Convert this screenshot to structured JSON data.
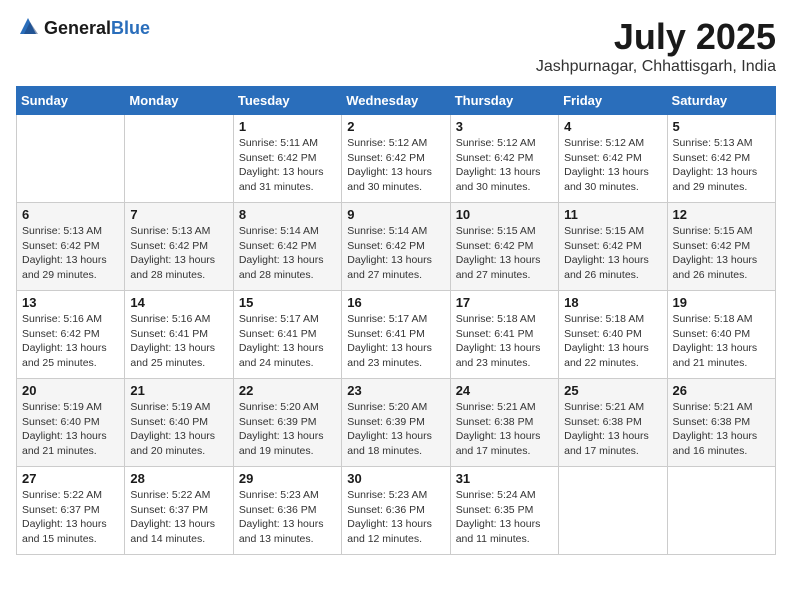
{
  "header": {
    "logo_general": "General",
    "logo_blue": "Blue",
    "month": "July 2025",
    "location": "Jashpurnagar, Chhattisgarh, India"
  },
  "weekdays": [
    "Sunday",
    "Monday",
    "Tuesday",
    "Wednesday",
    "Thursday",
    "Friday",
    "Saturday"
  ],
  "weeks": [
    [
      {
        "day": "",
        "detail": ""
      },
      {
        "day": "",
        "detail": ""
      },
      {
        "day": "1",
        "detail": "Sunrise: 5:11 AM\nSunset: 6:42 PM\nDaylight: 13 hours and 31 minutes."
      },
      {
        "day": "2",
        "detail": "Sunrise: 5:12 AM\nSunset: 6:42 PM\nDaylight: 13 hours and 30 minutes."
      },
      {
        "day": "3",
        "detail": "Sunrise: 5:12 AM\nSunset: 6:42 PM\nDaylight: 13 hours and 30 minutes."
      },
      {
        "day": "4",
        "detail": "Sunrise: 5:12 AM\nSunset: 6:42 PM\nDaylight: 13 hours and 30 minutes."
      },
      {
        "day": "5",
        "detail": "Sunrise: 5:13 AM\nSunset: 6:42 PM\nDaylight: 13 hours and 29 minutes."
      }
    ],
    [
      {
        "day": "6",
        "detail": "Sunrise: 5:13 AM\nSunset: 6:42 PM\nDaylight: 13 hours and 29 minutes."
      },
      {
        "day": "7",
        "detail": "Sunrise: 5:13 AM\nSunset: 6:42 PM\nDaylight: 13 hours and 28 minutes."
      },
      {
        "day": "8",
        "detail": "Sunrise: 5:14 AM\nSunset: 6:42 PM\nDaylight: 13 hours and 28 minutes."
      },
      {
        "day": "9",
        "detail": "Sunrise: 5:14 AM\nSunset: 6:42 PM\nDaylight: 13 hours and 27 minutes."
      },
      {
        "day": "10",
        "detail": "Sunrise: 5:15 AM\nSunset: 6:42 PM\nDaylight: 13 hours and 27 minutes."
      },
      {
        "day": "11",
        "detail": "Sunrise: 5:15 AM\nSunset: 6:42 PM\nDaylight: 13 hours and 26 minutes."
      },
      {
        "day": "12",
        "detail": "Sunrise: 5:15 AM\nSunset: 6:42 PM\nDaylight: 13 hours and 26 minutes."
      }
    ],
    [
      {
        "day": "13",
        "detail": "Sunrise: 5:16 AM\nSunset: 6:42 PM\nDaylight: 13 hours and 25 minutes."
      },
      {
        "day": "14",
        "detail": "Sunrise: 5:16 AM\nSunset: 6:41 PM\nDaylight: 13 hours and 25 minutes."
      },
      {
        "day": "15",
        "detail": "Sunrise: 5:17 AM\nSunset: 6:41 PM\nDaylight: 13 hours and 24 minutes."
      },
      {
        "day": "16",
        "detail": "Sunrise: 5:17 AM\nSunset: 6:41 PM\nDaylight: 13 hours and 23 minutes."
      },
      {
        "day": "17",
        "detail": "Sunrise: 5:18 AM\nSunset: 6:41 PM\nDaylight: 13 hours and 23 minutes."
      },
      {
        "day": "18",
        "detail": "Sunrise: 5:18 AM\nSunset: 6:40 PM\nDaylight: 13 hours and 22 minutes."
      },
      {
        "day": "19",
        "detail": "Sunrise: 5:18 AM\nSunset: 6:40 PM\nDaylight: 13 hours and 21 minutes."
      }
    ],
    [
      {
        "day": "20",
        "detail": "Sunrise: 5:19 AM\nSunset: 6:40 PM\nDaylight: 13 hours and 21 minutes."
      },
      {
        "day": "21",
        "detail": "Sunrise: 5:19 AM\nSunset: 6:40 PM\nDaylight: 13 hours and 20 minutes."
      },
      {
        "day": "22",
        "detail": "Sunrise: 5:20 AM\nSunset: 6:39 PM\nDaylight: 13 hours and 19 minutes."
      },
      {
        "day": "23",
        "detail": "Sunrise: 5:20 AM\nSunset: 6:39 PM\nDaylight: 13 hours and 18 minutes."
      },
      {
        "day": "24",
        "detail": "Sunrise: 5:21 AM\nSunset: 6:38 PM\nDaylight: 13 hours and 17 minutes."
      },
      {
        "day": "25",
        "detail": "Sunrise: 5:21 AM\nSunset: 6:38 PM\nDaylight: 13 hours and 17 minutes."
      },
      {
        "day": "26",
        "detail": "Sunrise: 5:21 AM\nSunset: 6:38 PM\nDaylight: 13 hours and 16 minutes."
      }
    ],
    [
      {
        "day": "27",
        "detail": "Sunrise: 5:22 AM\nSunset: 6:37 PM\nDaylight: 13 hours and 15 minutes."
      },
      {
        "day": "28",
        "detail": "Sunrise: 5:22 AM\nSunset: 6:37 PM\nDaylight: 13 hours and 14 minutes."
      },
      {
        "day": "29",
        "detail": "Sunrise: 5:23 AM\nSunset: 6:36 PM\nDaylight: 13 hours and 13 minutes."
      },
      {
        "day": "30",
        "detail": "Sunrise: 5:23 AM\nSunset: 6:36 PM\nDaylight: 13 hours and 12 minutes."
      },
      {
        "day": "31",
        "detail": "Sunrise: 5:24 AM\nSunset: 6:35 PM\nDaylight: 13 hours and 11 minutes."
      },
      {
        "day": "",
        "detail": ""
      },
      {
        "day": "",
        "detail": ""
      }
    ]
  ]
}
